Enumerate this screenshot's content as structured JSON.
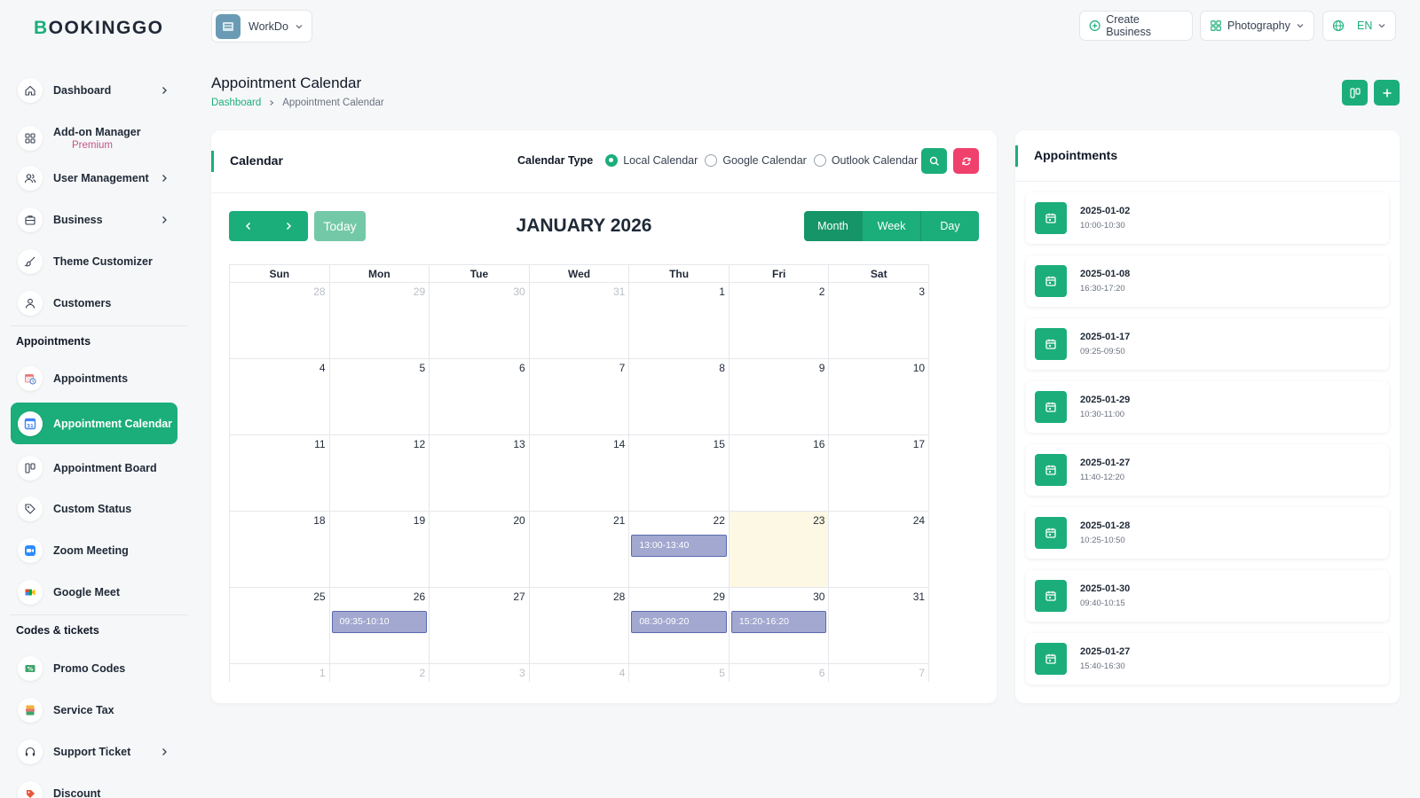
{
  "app": {
    "logo_b": "B",
    "logo_rest": "OOKINGGO"
  },
  "workspace": {
    "name": "WorkDo"
  },
  "topbar": {
    "create_business": "Create Business",
    "business_type": "Photography",
    "language": "EN"
  },
  "sidebar": {
    "items_top": [
      {
        "key": "dashboard",
        "label": "Dashboard",
        "icon": "home-icon",
        "chevron": true
      },
      {
        "key": "addon",
        "label": "Add-on Manager",
        "sub": "Premium",
        "icon": "grid-icon",
        "chevron": false
      },
      {
        "key": "users",
        "label": "User Management",
        "icon": "users-icon",
        "chevron": true
      },
      {
        "key": "business",
        "label": "Business",
        "icon": "briefcase-icon",
        "chevron": true
      },
      {
        "key": "theme",
        "label": "Theme Customizer",
        "icon": "brush-icon",
        "chevron": false
      },
      {
        "key": "customers",
        "label": "Customers",
        "icon": "user-icon",
        "chevron": false
      }
    ],
    "section_appointments": "Appointments",
    "items_appointments": [
      {
        "key": "appointments",
        "label": "Appointments",
        "icon": "calendar-clock-icon"
      },
      {
        "key": "appointment-calendar",
        "label": "Appointment Calendar",
        "icon": "google-calendar-icon",
        "active": true
      },
      {
        "key": "appointment-board",
        "label": "Appointment Board",
        "icon": "board-icon"
      },
      {
        "key": "custom-status",
        "label": "Custom Status",
        "icon": "tag-icon"
      },
      {
        "key": "zoom",
        "label": "Zoom Meeting",
        "icon": "zoom-icon"
      },
      {
        "key": "meet",
        "label": "Google Meet",
        "icon": "google-meet-icon"
      }
    ],
    "section_codes": "Codes & tickets",
    "items_codes": [
      {
        "key": "promo",
        "label": "Promo Codes",
        "icon": "percent-ticket-icon",
        "chevron": false
      },
      {
        "key": "tax",
        "label": "Service Tax",
        "icon": "tax-icon",
        "chevron": false
      },
      {
        "key": "support",
        "label": "Support Ticket",
        "icon": "headset-icon",
        "chevron": true
      },
      {
        "key": "discount",
        "label": "Discount",
        "icon": "discount-tag-icon",
        "chevron": false
      }
    ]
  },
  "page": {
    "title": "Appointment Calendar",
    "breadcrumb": {
      "home": "Dashboard",
      "current": "Appointment Calendar"
    }
  },
  "calendar": {
    "card_title": "Calendar",
    "type_label": "Calendar Type",
    "types": [
      "Local Calendar",
      "Google Calendar",
      "Outlook Calendar"
    ],
    "selected_type": 0,
    "today_label": "Today",
    "month_title": "JANUARY 2026",
    "views": [
      "Month",
      "Week",
      "Day"
    ],
    "weekdays": [
      "Sun",
      "Mon",
      "Tue",
      "Wed",
      "Thu",
      "Fri",
      "Sat"
    ],
    "weeks": [
      [
        {
          "d": "28",
          "o": true
        },
        {
          "d": "29",
          "o": true
        },
        {
          "d": "30",
          "o": true
        },
        {
          "d": "31",
          "o": true
        },
        {
          "d": "1"
        },
        {
          "d": "2"
        },
        {
          "d": "3"
        }
      ],
      [
        {
          "d": "4"
        },
        {
          "d": "5"
        },
        {
          "d": "6"
        },
        {
          "d": "7"
        },
        {
          "d": "8"
        },
        {
          "d": "9"
        },
        {
          "d": "10"
        }
      ],
      [
        {
          "d": "11"
        },
        {
          "d": "12"
        },
        {
          "d": "13"
        },
        {
          "d": "14"
        },
        {
          "d": "15"
        },
        {
          "d": "16"
        },
        {
          "d": "17"
        }
      ],
      [
        {
          "d": "18"
        },
        {
          "d": "19"
        },
        {
          "d": "20"
        },
        {
          "d": "21"
        },
        {
          "d": "22",
          "e": "13:00-13:40"
        },
        {
          "d": "23",
          "t": true
        },
        {
          "d": "24"
        }
      ],
      [
        {
          "d": "25"
        },
        {
          "d": "26",
          "e": "09:35-10:10"
        },
        {
          "d": "27"
        },
        {
          "d": "28"
        },
        {
          "d": "29",
          "e": "08:30-09:20"
        },
        {
          "d": "30",
          "e": "15:20-16:20"
        },
        {
          "d": "31"
        }
      ],
      [
        {
          "d": "1",
          "o": true
        },
        {
          "d": "2",
          "o": true
        },
        {
          "d": "3",
          "o": true
        },
        {
          "d": "4",
          "o": true
        },
        {
          "d": "5",
          "o": true
        },
        {
          "d": "6",
          "o": true
        },
        {
          "d": "7",
          "o": true
        }
      ]
    ]
  },
  "appointments": {
    "title": "Appointments",
    "items": [
      {
        "date": "2025-01-02",
        "time": "10:00-10:30"
      },
      {
        "date": "2025-01-08",
        "time": "16:30-17:20"
      },
      {
        "date": "2025-01-17",
        "time": "09:25-09:50"
      },
      {
        "date": "2025-01-29",
        "time": "10:30-11:00"
      },
      {
        "date": "2025-01-27",
        "time": "11:40-12:20"
      },
      {
        "date": "2025-01-28",
        "time": "10:25-10:50"
      },
      {
        "date": "2025-01-30",
        "time": "09:40-10:15"
      },
      {
        "date": "2025-01-27",
        "time": "15:40-16:30"
      }
    ]
  },
  "colors": {
    "brand": "#1bae7a",
    "danger": "#f0406c",
    "event": "#a2a8cf",
    "today": "#fcf8e3"
  }
}
